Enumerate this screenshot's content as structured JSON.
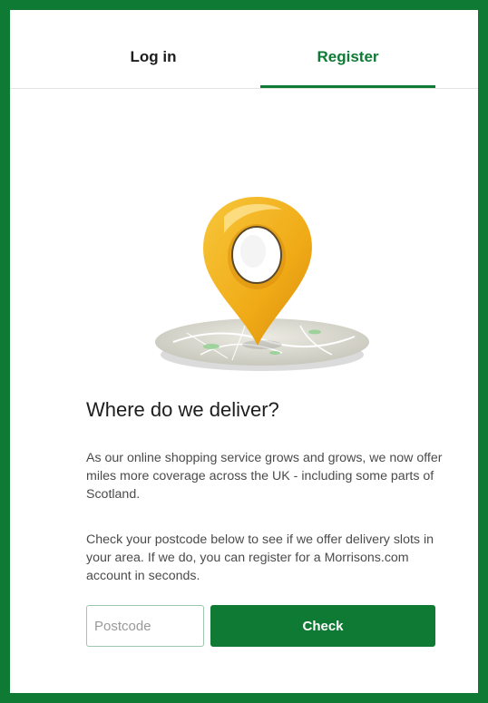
{
  "tabs": {
    "login_label": "Log in",
    "register_label": "Register",
    "active": "register"
  },
  "hero": {
    "icon": "map-pin-icon"
  },
  "main": {
    "title": "Where do we deliver?",
    "paragraph1": "As our online shopping service grows and grows, we now offer miles more coverage across the UK - including some parts of Scotland.",
    "paragraph2": "Check your postcode below to see if we offer delivery slots in your area. If we do, you can register for a Morrisons.com account in seconds."
  },
  "form": {
    "postcode_placeholder": "Postcode",
    "postcode_value": "",
    "check_label": "Check"
  },
  "colors": {
    "brand_green": "#0f7a34",
    "pin_yellow": "#f2b21b"
  }
}
